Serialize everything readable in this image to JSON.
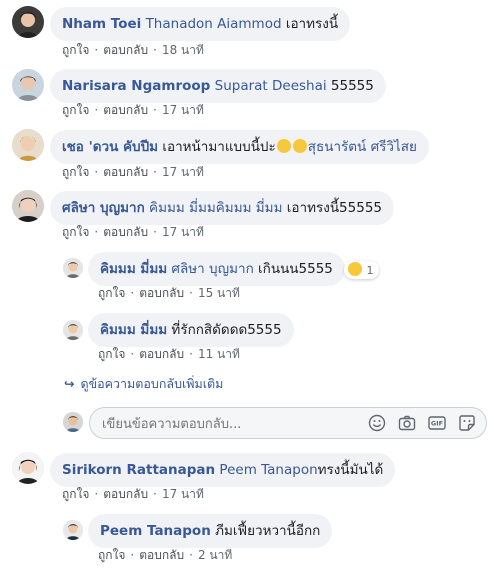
{
  "actions": {
    "like": "ถูกใจ",
    "reply": "ตอบกลับ",
    "separator": "·"
  },
  "comments": [
    {
      "author": "Nham Toei",
      "mention": "Thanadon Aiammod",
      "text": " เอาทรงนี้",
      "time": "18 นาที"
    },
    {
      "author": "Narisara Ngamroop",
      "mention": "Suparat Deeshai",
      "text": " 55555",
      "time": "17 นาที"
    },
    {
      "author": "เชอ 'ดวน คับปีม",
      "text_before": " เอาหน้ามาแบบนี้ปะ",
      "emoji_count": 2,
      "mention": "สุธนารัตน์ ศรีวิไสย",
      "time": "17 นาที"
    },
    {
      "author": "ศลิษา บุญมาก",
      "mention": "คิมมม มี่มมคิมมม มี่มม",
      "text": " เอาทรงนี้55555",
      "time": "17 นาที",
      "replies": [
        {
          "author": "คิมมม มี่มม",
          "mention": "ศลิษา บุญมาก",
          "text": " เกินนน5555",
          "time": "15 นาที",
          "reaction_count": "1"
        },
        {
          "author": "คิมมม มี่มม",
          "text": " ที่รักกสิดัดดด5555",
          "time": "11 นาที"
        }
      ],
      "more_replies": "ดูข้อความตอบกลับเพิ่มเติม",
      "reply_placeholder": "เขียนข้อความตอบกลับ..."
    },
    {
      "author": "Sirikorn Rattanapan",
      "mention": "Peem Tanapon",
      "text": "ทรงนี้มันได้",
      "time": "17 นาที",
      "replies": [
        {
          "author": "Peem Tanapon",
          "text": " ภีมเฟี้ยวหวานี้อีกก",
          "time": "2 นาที"
        }
      ]
    }
  ],
  "reply_tools": [
    "emoji-icon",
    "camera-icon",
    "gif-icon",
    "sticker-icon"
  ],
  "gif_label": "GIF",
  "colors": {
    "name": "#385898",
    "bubble": "#f0f2f5",
    "meta": "#606770"
  }
}
